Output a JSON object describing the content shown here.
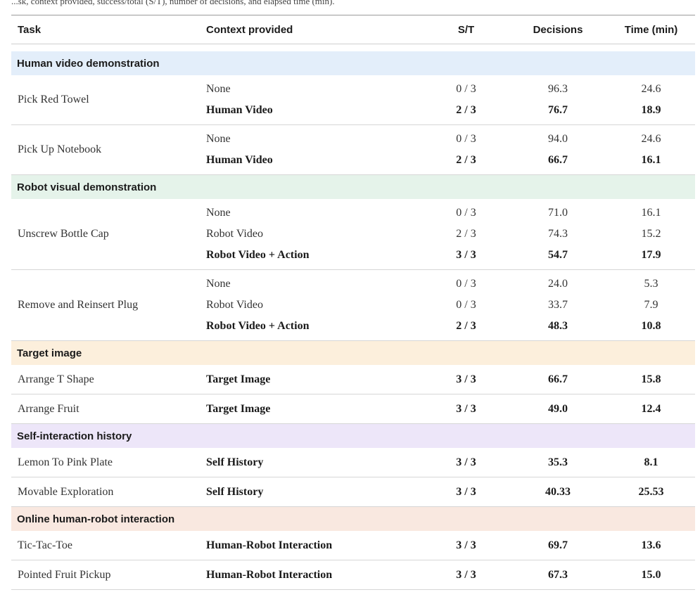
{
  "caption_fragment": "...sk, context provided, success/total (S/T), number of decisions, and elapsed time (min).",
  "columns": [
    "Task",
    "Context provided",
    "S/T",
    "Decisions",
    "Time (min)"
  ],
  "colors": {
    "human_video": "#e3eefa",
    "robot_visual": "#e5f3ea",
    "target_image": "#fcefdc",
    "self_history": "#ede6f9",
    "online_hri": "#f9e8e0",
    "rule": "#d6d6d6"
  },
  "sections": [
    {
      "title": "Human video demonstration",
      "groups": [
        {
          "task": "Pick Red Towel",
          "rows": [
            {
              "context": "None",
              "st": "0 / 3",
              "decisions": "96.3",
              "time": "24.6",
              "bold": false
            },
            {
              "context": "Human Video",
              "st": "2 / 3",
              "decisions": "76.7",
              "time": "18.9",
              "bold": true
            }
          ]
        },
        {
          "task": "Pick Up Notebook",
          "rows": [
            {
              "context": "None",
              "st": "0 / 3",
              "decisions": "94.0",
              "time": "24.6",
              "bold": false
            },
            {
              "context": "Human Video",
              "st": "2 / 3",
              "decisions": "66.7",
              "time": "16.1",
              "bold": true
            }
          ]
        }
      ]
    },
    {
      "title": "Robot visual demonstration",
      "groups": [
        {
          "task": "Unscrew Bottle Cap",
          "rows": [
            {
              "context": "None",
              "st": "0 / 3",
              "decisions": "71.0",
              "time": "16.1",
              "bold": false
            },
            {
              "context": "Robot Video",
              "st": "2 / 3",
              "decisions": "74.3",
              "time": "15.2",
              "bold": false
            },
            {
              "context": "Robot Video + Action",
              "st": "3 / 3",
              "decisions": "54.7",
              "time": "17.9",
              "bold": true
            }
          ]
        },
        {
          "task": "Remove and Reinsert Plug",
          "rows": [
            {
              "context": "None",
              "st": "0 / 3",
              "decisions": "24.0",
              "time": "5.3",
              "bold": false
            },
            {
              "context": "Robot Video",
              "st": "0 / 3",
              "decisions": "33.7",
              "time": "7.9",
              "bold": false
            },
            {
              "context": "Robot Video + Action",
              "st": "2 / 3",
              "decisions": "48.3",
              "time": "10.8",
              "bold": true
            }
          ]
        }
      ]
    },
    {
      "title": "Target image",
      "groups": [
        {
          "task": "Arrange T Shape",
          "rows": [
            {
              "context": "Target Image",
              "st": "3 / 3",
              "decisions": "66.7",
              "time": "15.8",
              "bold": true
            }
          ]
        },
        {
          "task": "Arrange Fruit",
          "rows": [
            {
              "context": "Target Image",
              "st": "3 / 3",
              "decisions": "49.0",
              "time": "12.4",
              "bold": true
            }
          ]
        }
      ]
    },
    {
      "title": "Self-interaction history",
      "groups": [
        {
          "task": "Lemon To Pink Plate",
          "rows": [
            {
              "context": "Self History",
              "st": "3 / 3",
              "decisions": "35.3",
              "time": "8.1",
              "bold": true
            }
          ]
        },
        {
          "task": "Movable Exploration",
          "rows": [
            {
              "context": "Self History",
              "st": "3 / 3",
              "decisions": "40.33",
              "time": "25.53",
              "bold": true
            }
          ]
        }
      ]
    },
    {
      "title": "Online human-robot interaction",
      "groups": [
        {
          "task": "Tic-Tac-Toe",
          "rows": [
            {
              "context": "Human-Robot Interaction",
              "st": "3 / 3",
              "decisions": "69.7",
              "time": "13.6",
              "bold": true
            }
          ]
        },
        {
          "task": "Pointed Fruit Pickup",
          "rows": [
            {
              "context": "Human-Robot Interaction",
              "st": "3 / 3",
              "decisions": "67.3",
              "time": "15.0",
              "bold": true
            }
          ]
        }
      ]
    }
  ]
}
